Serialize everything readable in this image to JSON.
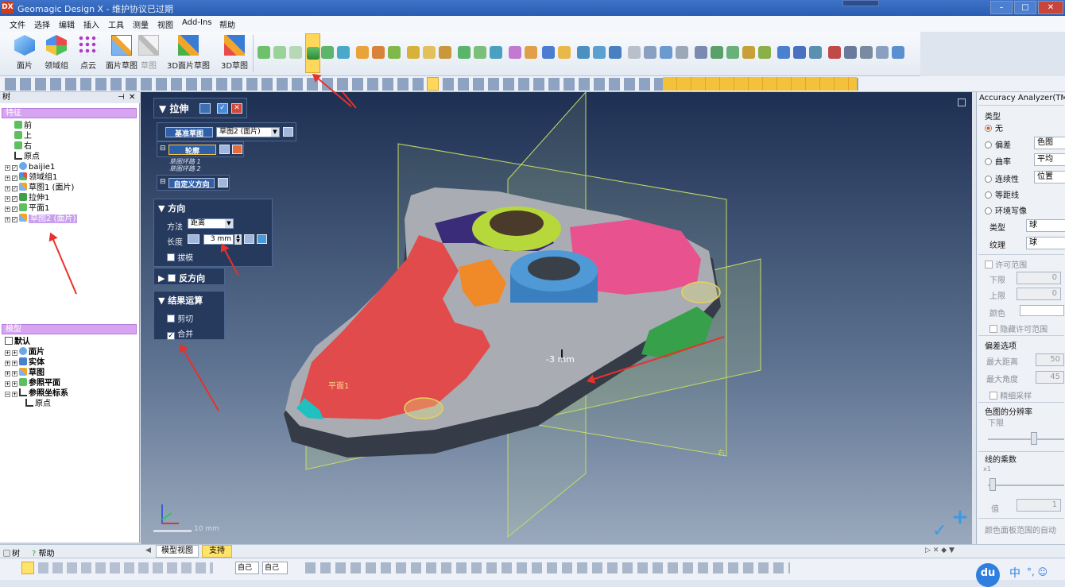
{
  "window": {
    "app_icon": "DX",
    "title": "Geomagic Design X - 维护协议已过期",
    "controls": [
      "–",
      "□",
      "✕"
    ]
  },
  "menu": [
    "文件",
    "选择",
    "编辑",
    "插入",
    "工具",
    "测量",
    "视图",
    "Add-Ins",
    "帮助"
  ],
  "ribbon": {
    "buttons": [
      {
        "label": "面片",
        "icon": "mesh-icon"
      },
      {
        "label": "领域组",
        "icon": "region-group-icon"
      },
      {
        "label": "点云",
        "icon": "point-cloud-icon"
      },
      {
        "label": "面片草图",
        "icon": "mesh-sketch-icon"
      },
      {
        "label": "草图",
        "icon": "sketch-icon"
      },
      {
        "label": "3D面片草图",
        "icon": "3d-mesh-sketch-icon"
      },
      {
        "label": "3D草图",
        "icon": "3d-sketch-icon"
      }
    ],
    "active_tool": "extrude-icon"
  },
  "tree_panel": {
    "header": "树",
    "features_label": "特征",
    "features": [
      {
        "label": "前",
        "icon": "plane-icon"
      },
      {
        "label": "上",
        "icon": "plane-icon"
      },
      {
        "label": "右",
        "icon": "plane-icon"
      },
      {
        "label": "原点",
        "icon": "origin-icon"
      },
      {
        "label": "baijie1",
        "icon": "mesh-icon"
      },
      {
        "label": "领域组1",
        "icon": "region-group-icon"
      },
      {
        "label": "草图1 (面片)",
        "icon": "mesh-sketch-icon"
      },
      {
        "label": "拉伸1",
        "icon": "extrude-icon"
      },
      {
        "label": "平面1",
        "icon": "plane-icon"
      },
      {
        "label": "草图2 (面片)",
        "icon": "mesh-sketch-icon"
      }
    ],
    "model_label": "模型",
    "model": [
      {
        "label": "默认"
      },
      {
        "label": "面片"
      },
      {
        "label": "实体"
      },
      {
        "label": "草图"
      },
      {
        "label": "参照平面"
      },
      {
        "label": "参照坐标系"
      },
      {
        "label": "原点"
      }
    ],
    "bottom_tabs": [
      "树",
      "帮助"
    ]
  },
  "extrude_dialog": {
    "title": "拉伸",
    "base_sketch_label": "基准草图",
    "base_sketch_value": "草图2 (面片)",
    "profile_label": "轮廓",
    "profiles": [
      "草图环路 1",
      "草图环路 2"
    ],
    "custom_direction_label": "自定义方向",
    "direction_title": "方向",
    "method_label": "方法",
    "method_value": "距离",
    "length_label": "长度",
    "length_value": "3 mm",
    "draft_label": "拔模",
    "reverse_label": "反方向",
    "result_title": "结果运算",
    "cut_label": "剪切",
    "cut_checked": false,
    "merge_label": "合并",
    "merge_checked": true
  },
  "viewport": {
    "dimension_label": "-3 mm",
    "plane_label": "平面1",
    "scale_label": "10 mm",
    "tabs": [
      "模型视图",
      "支持"
    ],
    "active_tab": "支持"
  },
  "right_panel": {
    "title": "Accuracy Analyzer(TM)",
    "type_label": "类型",
    "options": [
      {
        "label": "无",
        "value": "",
        "selected": true
      },
      {
        "label": "偏差",
        "value": "色图",
        "selected": false
      },
      {
        "label": "曲率",
        "value": "平均",
        "selected": false
      },
      {
        "label": "连续性",
        "value": "位置",
        "selected": false
      },
      {
        "label": "等距线",
        "value": "",
        "selected": false
      },
      {
        "label": "环境写像",
        "value": "",
        "selected": false
      }
    ],
    "type_field_label": "类型",
    "type_field_value": "球",
    "texture_label": "纹理",
    "texture_value": "球",
    "tolerance_title": "许可范围",
    "lower_label": "下限",
    "lower_value": "0",
    "upper_label": "上限",
    "upper_value": "0",
    "color_label": "颜色",
    "hide_tolerance_label": "隐藏许可范围",
    "deviation_title": "偏差选项",
    "max_distance_label": "最大距离",
    "max_distance_value": "50",
    "max_angle_label": "最大角度",
    "max_angle_value": "45",
    "fine_sampling_label": "精细采样",
    "resolution_title": "色图的分辨率",
    "resolution_low_label": "下限",
    "line_multiplier_title": "线的乘数",
    "multiplier_label": "x1",
    "value_label": "值",
    "value_value": "1",
    "auto_range_label": "颜色面板范围的自动"
  },
  "status": {
    "combo1": "自己",
    "combo2": "自己",
    "ime_label": "中"
  }
}
